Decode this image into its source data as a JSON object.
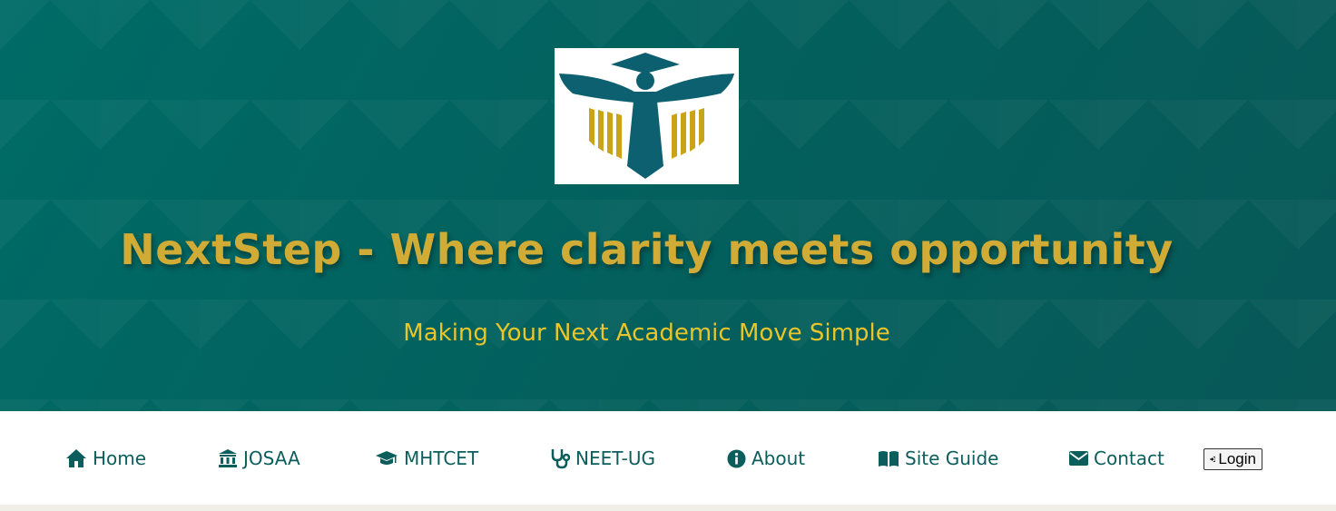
{
  "hero": {
    "title": "NextStep - Where clarity meets opportunity",
    "subtitle": "Making Your Next Academic Move Simple",
    "logo_icon": "graduate-wings-logo"
  },
  "nav": {
    "items": [
      {
        "label": "Home",
        "icon": "home-icon"
      },
      {
        "label": "JOSAA",
        "icon": "institution-icon"
      },
      {
        "label": "MHTCET",
        "icon": "graduation-cap-icon"
      },
      {
        "label": "NEET-UG",
        "icon": "stethoscope-icon"
      },
      {
        "label": "About",
        "icon": "info-icon"
      },
      {
        "label": "Site Guide",
        "icon": "book-icon"
      },
      {
        "label": "Contact",
        "icon": "envelope-icon"
      }
    ],
    "login_label": "Login",
    "login_icon": "sign-in-icon"
  },
  "colors": {
    "hero_bg": "#036560",
    "title": "#d0ab35",
    "subtitle": "#e8c52a",
    "nav_text": "#0b5e5c"
  }
}
